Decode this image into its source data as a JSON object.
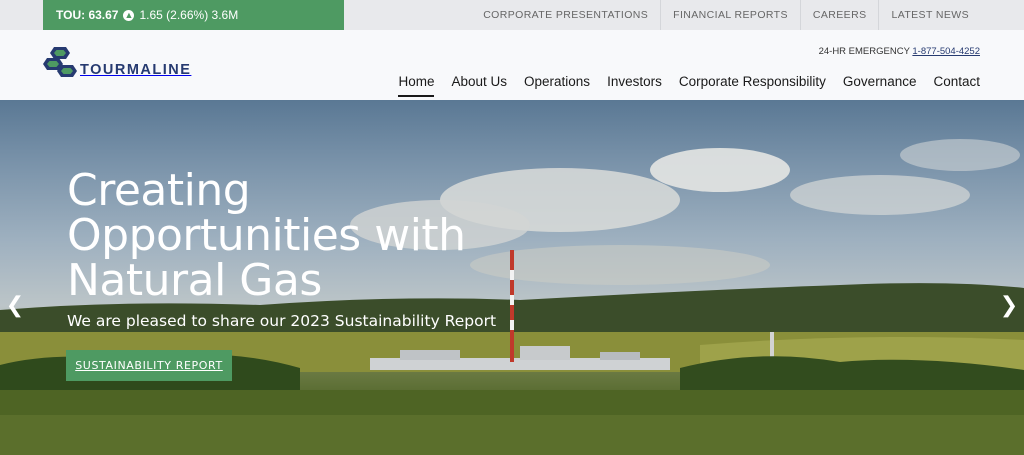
{
  "ticker": {
    "symbol": "TOU: 63.67",
    "change": "1.65 (2.66%) 3.6M",
    "icon": "arrow-up-circle-icon"
  },
  "utility_nav": [
    "CORPORATE PRESENTATIONS",
    "FINANCIAL REPORTS",
    "CAREERS",
    "LATEST NEWS"
  ],
  "logo": {
    "text": "TOURMALINE",
    "color": "#263a70"
  },
  "emergency": {
    "label": "24-HR EMERGENCY",
    "phone": "1-877-504-4252"
  },
  "main_nav": {
    "home": "Home",
    "about": "About Us",
    "operations": "Operations",
    "investors": "Investors",
    "responsibility": "Corporate Responsibility",
    "governance": "Governance",
    "contact": "Contact"
  },
  "hero": {
    "title": "Creating\nOpportunities with\nNatural Gas",
    "subtitle": "We are pleased to share our 2023 Sustainability Report",
    "button": "SUSTAINABILITY REPORT",
    "prev": "❮",
    "next": "❯"
  },
  "colors": {
    "accent_green": "#4e9a62",
    "brand_navy": "#263a70"
  }
}
